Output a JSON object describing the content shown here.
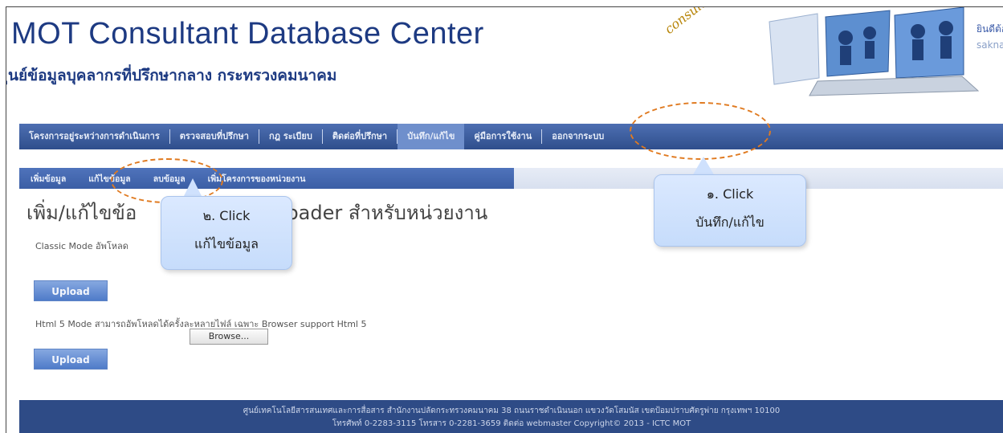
{
  "header": {
    "title": "MOT Consultant Database Center",
    "subtitle": "ูนย์ข้อมูลบุคลากรที่ปรึกษากลาง กระทรวงคมนาคม",
    "logo_word": "consultant",
    "welcome": "ยินดีต้อนรับ",
    "username": "saknarong m"
  },
  "main_nav": {
    "items": [
      {
        "label": "โครงการอยู่ระหว่างการดำเนินการ"
      },
      {
        "label": "ตรวจสอบที่ปรึกษา"
      },
      {
        "label": "กฎ ระเบียบ"
      },
      {
        "label": "ติดต่อที่ปรึกษา"
      },
      {
        "label": "บันทึก/แก้ไข"
      },
      {
        "label": "คู่มือการใช้งาน"
      },
      {
        "label": "ออกจากระบบ"
      }
    ]
  },
  "sub_nav": {
    "items": [
      {
        "label": "เพิ่มข้อมูล"
      },
      {
        "label": "แก้ไขข้อมูล"
      },
      {
        "label": "ลบข้อมูล"
      },
      {
        "label": "เพิ่มโครงการของหน่วยงาน"
      }
    ]
  },
  "content": {
    "heading": "เพิ่ม/แก้ไขข้อ",
    "heading_tail": "Loader สำหรับหน่วยงาน",
    "classic_label": "Classic Mode อัพโหลด",
    "upload_label": "Upload",
    "html5_label": "Html 5 Mode สามารถอัพโหลดได้ครั้งละหลายไฟล์ เฉพาะ Browser support Html 5",
    "browse_label": "Browse..."
  },
  "footer": {
    "line1": "ศูนย์เทคโนโลยีสารสนเทศและการสื่อสาร สำนักงานปลัดกระทรวงคมนาคม 38 ถนนราชดำเนินนอก แขวงวัดโสมนัส เขตป้อมปราบศัตรูพ่าย กรุงเทพฯ 10100",
    "line2": "โทรศัพท์ 0-2283-3115 โทรสาร 0-2281-3659 ติดต่อ webmaster Copyright© 2013 - ICTC MOT"
  },
  "callouts": {
    "first": {
      "step": "๑. Click",
      "target": "บันทึก/แก้ไข"
    },
    "second": {
      "step": "๒. Click",
      "target": "แก้ไขข้อมูล"
    }
  },
  "colors": {
    "nav": "#2f4e8c",
    "title": "#1d3a82",
    "callout": "#c6dcfb",
    "ring": "#e07a20"
  }
}
